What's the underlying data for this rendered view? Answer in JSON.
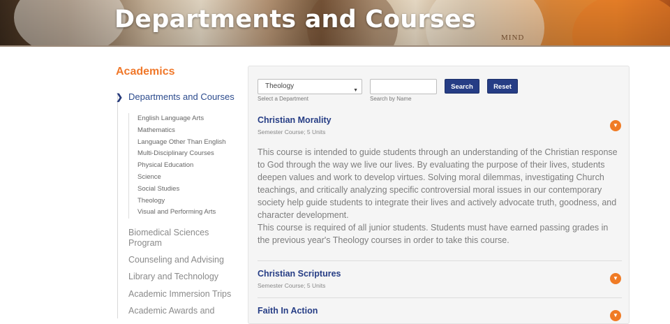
{
  "hero": {
    "title": "Departments and Courses",
    "logo_text": "MIND"
  },
  "sidebar": {
    "title": "Academics",
    "active_item": "Departments and Courses",
    "sub_items": [
      "English Language Arts",
      "Mathematics",
      "Language Other Than English",
      "Multi-Disciplinary Courses",
      "Physical Education",
      "Science",
      "Social Studies",
      "Theology",
      "Visual and Performing Arts"
    ],
    "other_items": [
      "Biomedical Sciences Program",
      "Counseling and Advising",
      "Library and Technology",
      "Academic Immersion Trips",
      "Academic Awards and"
    ]
  },
  "filter": {
    "department_value": "Theology",
    "department_hint": "Select a Department",
    "name_value": "",
    "name_hint": "Search by Name",
    "search_label": "Search",
    "reset_label": "Reset"
  },
  "courses": [
    {
      "title": "Christian Morality",
      "meta": "Semester Course; 5 Units",
      "description": "This course is intended to guide students through an understanding of the Christian response to God through the way we live our lives. By evaluating the purpose of their lives, students deepen values and work to develop virtues. Solving moral dilemmas, investigating Church teachings, and critically analyzing specific controversial moral issues in our contemporary society help guide students to integrate their lives and actively advocate truth, goodness, and character development.",
      "requirement": "This course is required of all junior students. Students must have earned passing grades in the previous year's Theology courses in order to take this course."
    },
    {
      "title": "Christian Scriptures",
      "meta": "Semester Course; 5 Units"
    },
    {
      "title": "Faith In Action"
    }
  ],
  "colors": {
    "accent_orange": "#f07b25",
    "nav_blue": "#263d85",
    "panel_bg": "#f5f5f5"
  },
  "icons": {
    "active_marker": "chevron-right-icon",
    "toggle": "expand-circle-icon",
    "select_caret": "caret-down-icon"
  }
}
